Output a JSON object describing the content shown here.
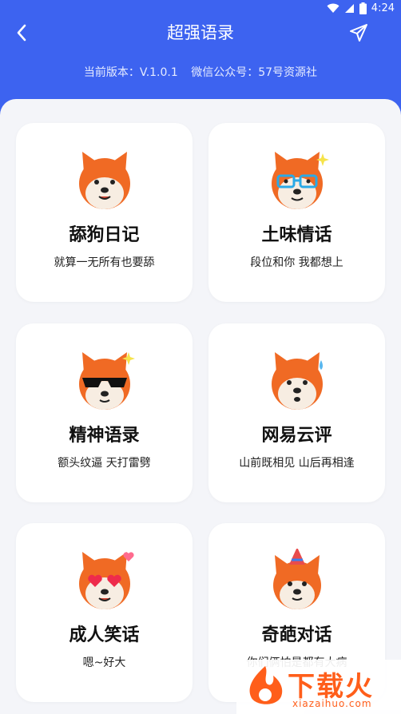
{
  "status_bar": {
    "time": "4:24"
  },
  "header": {
    "title": "超强语录"
  },
  "info": {
    "version": "当前版本：V.1.0.1",
    "wechat": "微信公众号：57号资源社"
  },
  "cards": [
    {
      "name": "舔狗日记",
      "desc": "就算一无所有也要舔"
    },
    {
      "name": "土味情话",
      "desc": "段位和你 我都想上"
    },
    {
      "name": "精神语录",
      "desc": "额头纹逼 天打雷劈"
    },
    {
      "name": "网易云评",
      "desc": "山前既相见 山后再相逢"
    },
    {
      "name": "成人笑话",
      "desc": "嗯~好大"
    },
    {
      "name": "奇葩对话",
      "desc": "你们俩怕是都有大病"
    }
  ],
  "watermark": {
    "brand": "下载火",
    "site": "xiazaihuo.com"
  }
}
